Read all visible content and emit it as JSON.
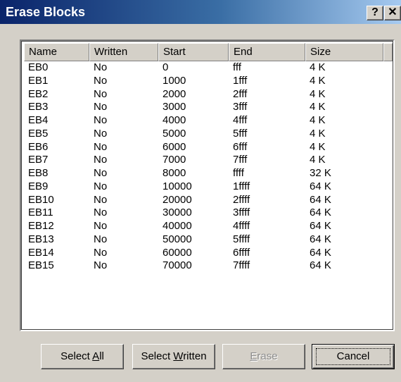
{
  "window": {
    "title": "Erase Blocks"
  },
  "titlebar": {
    "help_glyph": "?",
    "close_glyph": "✕"
  },
  "columns": [
    "Name",
    "Written",
    "Start",
    "End",
    "Size"
  ],
  "rows": [
    [
      "EB0",
      "No",
      "0",
      "fff",
      "4 K"
    ],
    [
      "EB1",
      "No",
      "1000",
      "1fff",
      "4 K"
    ],
    [
      "EB2",
      "No",
      "2000",
      "2fff",
      "4 K"
    ],
    [
      "EB3",
      "No",
      "3000",
      "3fff",
      "4 K"
    ],
    [
      "EB4",
      "No",
      "4000",
      "4fff",
      "4 K"
    ],
    [
      "EB5",
      "No",
      "5000",
      "5fff",
      "4 K"
    ],
    [
      "EB6",
      "No",
      "6000",
      "6fff",
      "4 K"
    ],
    [
      "EB7",
      "No",
      "7000",
      "7fff",
      "4 K"
    ],
    [
      "EB8",
      "No",
      "8000",
      "ffff",
      "32 K"
    ],
    [
      "EB9",
      "No",
      "10000",
      "1ffff",
      "64 K"
    ],
    [
      "EB10",
      "No",
      "20000",
      "2ffff",
      "64 K"
    ],
    [
      "EB11",
      "No",
      "30000",
      "3ffff",
      "64 K"
    ],
    [
      "EB12",
      "No",
      "40000",
      "4ffff",
      "64 K"
    ],
    [
      "EB13",
      "No",
      "50000",
      "5ffff",
      "64 K"
    ],
    [
      "EB14",
      "No",
      "60000",
      "6ffff",
      "64 K"
    ],
    [
      "EB15",
      "No",
      "70000",
      "7ffff",
      "64 K"
    ]
  ],
  "buttons": {
    "select_all": {
      "before": "Select ",
      "mnemonic": "A",
      "after": "ll"
    },
    "select_written": {
      "before": "Select ",
      "mnemonic": "W",
      "after": "ritten"
    },
    "erase": {
      "before": "",
      "mnemonic": "E",
      "after": "rase"
    },
    "cancel": {
      "label": "Cancel"
    }
  },
  "colors": {
    "face": "#d4d0c8",
    "titlebar_start": "#0a246a",
    "titlebar_end": "#a6caf0",
    "list_bg": "#ffffff"
  }
}
